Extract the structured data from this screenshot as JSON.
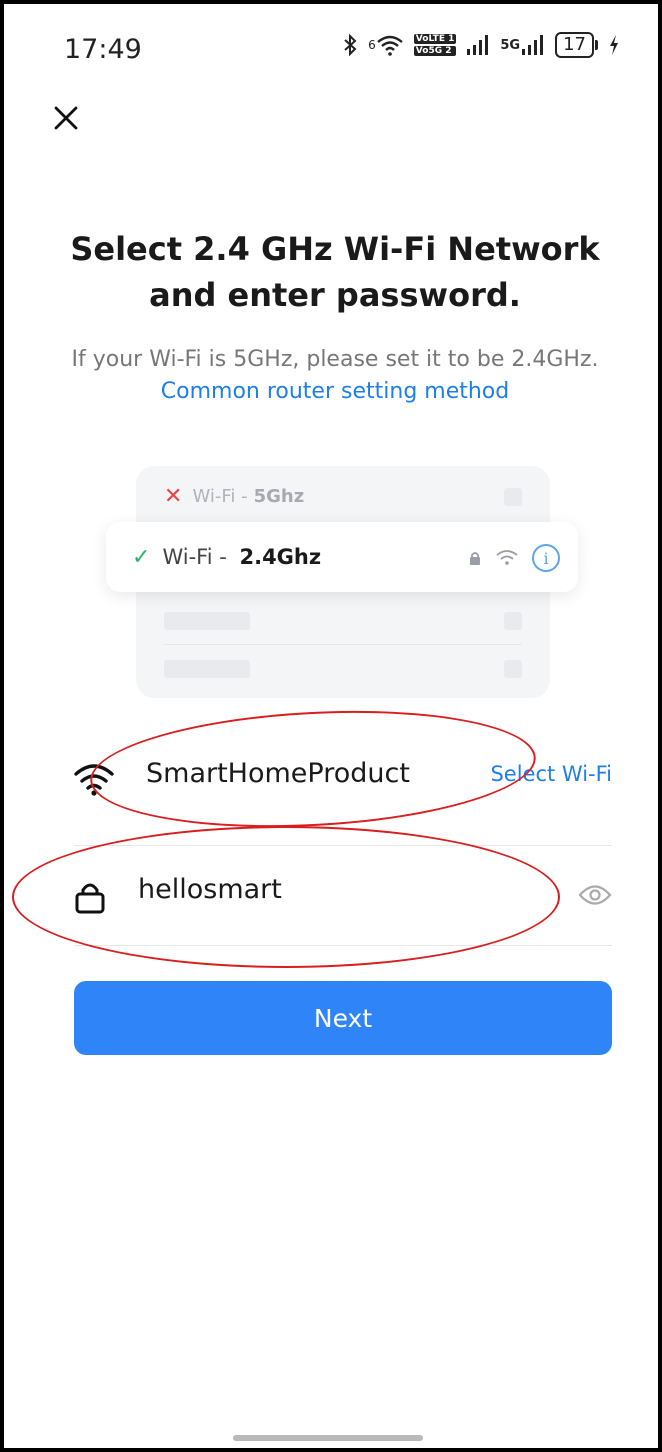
{
  "status_bar": {
    "time": "17:49",
    "wifi_badge": "6",
    "volte_top": "VoLTE 1",
    "volte_bottom": "Vo5G 2",
    "net_type": "5G",
    "battery": "17"
  },
  "header": {
    "close_icon": "close-icon"
  },
  "main": {
    "title": "Select 2.4 GHz Wi-Fi Network and enter password.",
    "subtitle": "If your Wi-Fi is 5GHz, please set it to be 2.4GHz.",
    "subtitle_link": "Common router setting method"
  },
  "illustration": {
    "row_5g_prefix": "Wi-Fi -",
    "row_5g_band": "5Ghz",
    "row_24_prefix": "Wi-Fi -",
    "row_24_band": "2.4Ghz",
    "info_glyph": "i"
  },
  "wifi": {
    "ssid": "SmartHomeProduct",
    "select_label": "Select Wi-Fi"
  },
  "password": {
    "value": "hellosmart"
  },
  "actions": {
    "next_label": "Next"
  },
  "colors": {
    "primary": "#2f84f7",
    "link": "#1e7fe8",
    "annotation": "#d81e1e"
  }
}
